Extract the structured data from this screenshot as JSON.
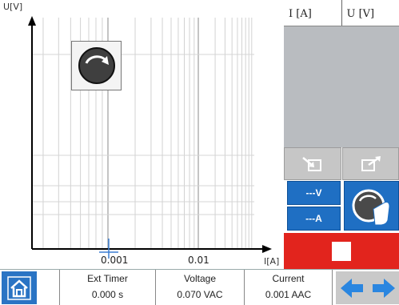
{
  "chart": {
    "y_axis_label": "U[V]",
    "x_axis_label": "I[A]",
    "x_ticks": [
      "0.001",
      "0.01"
    ],
    "x_scale": "log",
    "grid": true,
    "cursor_x": "0.001"
  },
  "results_table": {
    "columns": [
      "I [A]",
      "U [V]"
    ],
    "rows": []
  },
  "controls": {
    "voltage_range_label": "---V",
    "current_range_label": "---A"
  },
  "status_bar": {
    "timer_label": "Ext Timer",
    "timer_value": "0.000 s",
    "voltage_label": "Voltage",
    "voltage_value": "0.070 VAC",
    "current_label": "Current",
    "current_value": "0.001 AAC"
  },
  "colors": {
    "accent_blue": "#1f6fc3",
    "stop_red": "#e2241d",
    "cursor": "#3b7fd4"
  },
  "icons": [
    "rotate-knob-icon",
    "import-icon",
    "export-icon",
    "knob-hand-icon",
    "stop-icon",
    "home-icon",
    "arrow-left-icon",
    "arrow-right-icon"
  ]
}
